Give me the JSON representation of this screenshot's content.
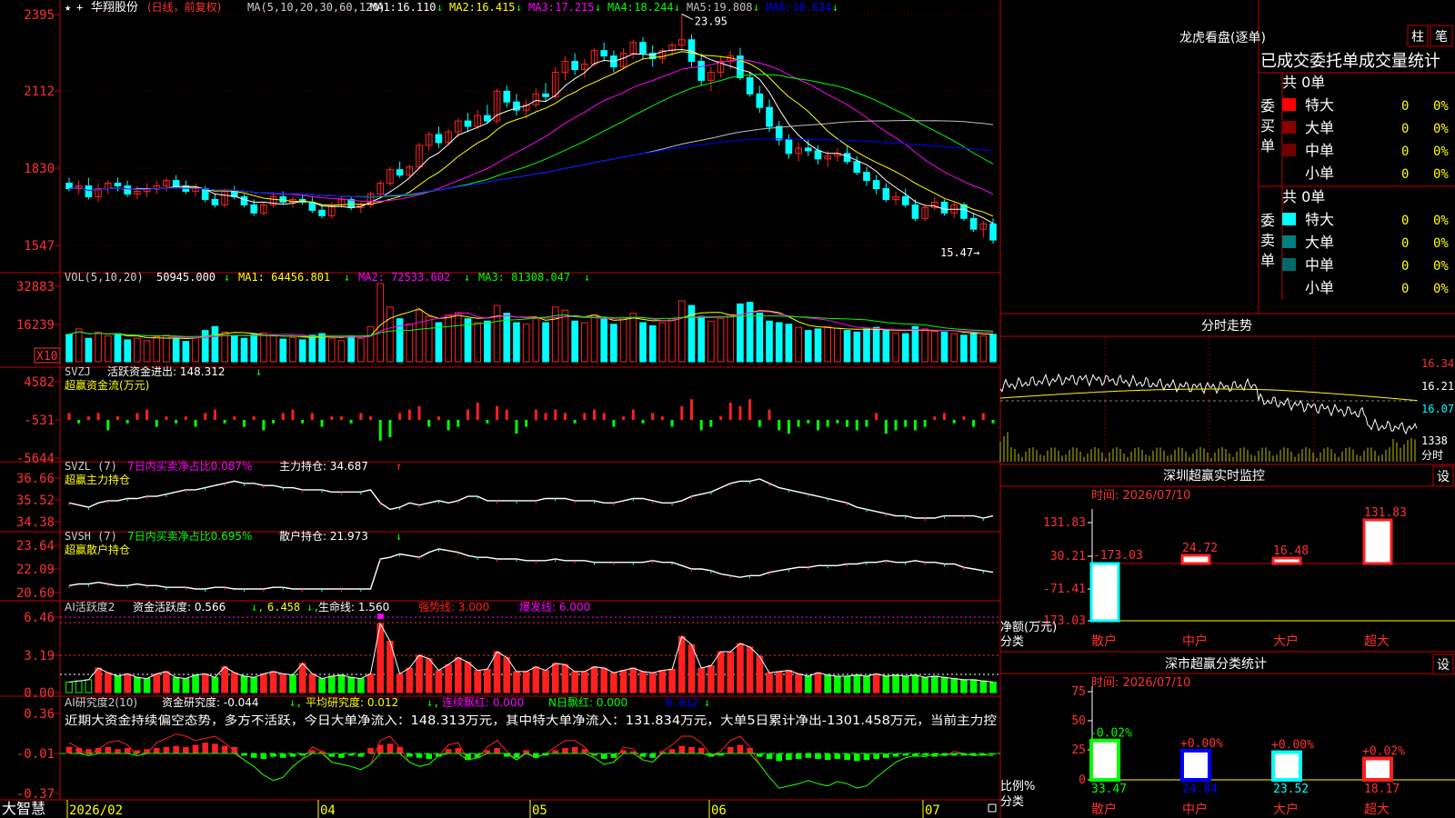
{
  "colors": {
    "up": "#ff2020",
    "down": "#00ffff",
    "grid": "#c00000",
    "bg": "#000000",
    "ma1": "#ffffff",
    "ma2": "#ffff00",
    "ma3": "#ff00ff",
    "ma4": "#00ff00",
    "ma5": "#c0c0c0",
    "ma6": "#0000ff"
  },
  "price_panel": {
    "stock": "华翔股份",
    "mode": "(日线，前复权)",
    "ma_params": "MA(5,10,20,30,60,120)",
    "ma_values": [
      {
        "label": "MA1:",
        "value": "16.110",
        "arrow": "↓"
      },
      {
        "label": "MA2:",
        "value": "16.415",
        "arrow": "↓"
      },
      {
        "label": "MA3:",
        "value": "17.215",
        "arrow": "↓"
      },
      {
        "label": "MA4:",
        "value": "18.244",
        "arrow": "↓"
      },
      {
        "label": "MA5:",
        "value": "19.808",
        "arrow": "↓"
      },
      {
        "label": "MA6:",
        "value": "18.624",
        "arrow": "↓"
      }
    ],
    "y_ticks": [
      "2395",
      "2112",
      "1830",
      "1547"
    ],
    "high_marker": "23.95",
    "low_marker": "15.47→"
  },
  "vol_panel": {
    "header": "VOL(5,10,20)",
    "value": "50945.000",
    "arrow": "↓",
    "ma1": "MA1: 64456.801",
    "ma2": "MA2: 72533.602",
    "ma3": "MA3: 81308.047",
    "y_ticks": [
      "32883",
      "16239"
    ],
    "unit": "X10"
  },
  "svzj_panel": {
    "header": "SVZJ",
    "label": "活跃资金进出: 148.312",
    "arrow": "↓",
    "subtitle": "超赢资金流(万元)",
    "y_ticks": [
      "4582",
      "-531",
      "-5644"
    ]
  },
  "svzl_panel": {
    "header": "SVZL (7)",
    "ratio": "7日内买卖净占比0.087%",
    "hold": "主力持仓: 34.687",
    "arrow": "↑",
    "subtitle": "超赢主力持仓",
    "y_ticks": [
      "36.66",
      "35.52",
      "34.38"
    ]
  },
  "svsh_panel": {
    "header": "SVSH (7)",
    "ratio": "7日内买卖净占比0.695%",
    "hold": "散户持仓: 21.973",
    "arrow": "↓",
    "subtitle": "超赢散户持仓",
    "y_ticks": [
      "23.64",
      "22.09",
      "20.60"
    ]
  },
  "ai_active_panel": {
    "header": "AI活跃度2",
    "line1": "资金活跃度: 0.566",
    "v2": "6.458",
    "line3": "生命线: 1.560",
    "line4": "强势线: 3.000",
    "line5": "爆发线: 6.000",
    "y_ticks": [
      "6.46",
      "3.19",
      "0.00"
    ]
  },
  "ai_research_panel": {
    "header": "AI研究度2(10)",
    "r1": "资金研究度: -0.044",
    "r2": "平均研究度: 0.012",
    "r3": "连续飘红: 0.000",
    "r4": "N日飘红: 0.000",
    "r5": "0.012",
    "commentary": "近期大资金持续偏空态势，多方不活跃，今日大单净流入：148.313万元，其中特大单净流入：131.834万元，大单5日累计净出-1301.458万元，当前主力控",
    "y_ticks": [
      "0.36",
      "-0.01",
      "-0.37"
    ]
  },
  "date_axis": {
    "brand": "大智慧",
    "labels": [
      "2026/02",
      "04",
      "05",
      "06",
      "07"
    ]
  },
  "order_book": {
    "title": "龙虎看盘(逐单)",
    "btn_bar": "柱",
    "btn_line": "笔",
    "section_title": "已成交委托单成交量统计",
    "buy": {
      "side": "委买单",
      "total": "共 0单",
      "rows": [
        {
          "name": "特大",
          "qty": "0",
          "pct": "0%"
        },
        {
          "name": "大单",
          "qty": "0",
          "pct": "0%"
        },
        {
          "name": "中单",
          "qty": "0",
          "pct": "0%"
        },
        {
          "name": "小单",
          "qty": "0",
          "pct": "0%"
        }
      ]
    },
    "sell": {
      "side": "委卖单",
      "total": "共 0单",
      "rows": [
        {
          "name": "特大",
          "qty": "0",
          "pct": "0%"
        },
        {
          "name": "大单",
          "qty": "0",
          "pct": "0%"
        },
        {
          "name": "中单",
          "qty": "0",
          "pct": "0%"
        },
        {
          "name": "小单",
          "qty": "0",
          "pct": "0%"
        }
      ]
    }
  },
  "intraday": {
    "title": "分时走势",
    "price_ticks": [
      "16.34",
      "16.21",
      "16.07"
    ],
    "vol_tick": "1338",
    "unit": "分时"
  },
  "monitor": {
    "title": "深圳超赢实时监控",
    "set": "设",
    "time": "时间: 2026/07/10",
    "y_ticks": [
      "131.83",
      "30.21",
      "-71.41",
      "-173.03"
    ],
    "label_net": "净额(万元)",
    "label_class": "分类",
    "cats": [
      "散户",
      "中户",
      "大户",
      "超大"
    ],
    "vals": [
      "-173.03",
      "24.72",
      "16.48",
      "131.83"
    ]
  },
  "classify": {
    "title": "深市超赢分类统计",
    "set": "设",
    "time": "时间: 2026/07/10",
    "y_ticks": [
      "75",
      "50",
      "25",
      "0"
    ],
    "label_ratio": "比例%",
    "label_class": "分类",
    "cats": [
      "散户",
      "中户",
      "大户",
      "超大"
    ],
    "changes": [
      "-0.02%",
      "+0.00%",
      "+0.00%",
      "+0.02%"
    ],
    "vals": [
      "33.47",
      "24.84",
      "23.52",
      "18.17"
    ]
  },
  "chart_data": {
    "type": "candlestick",
    "title": "华翔股份(日线，前复权)",
    "y_range": [
      15.47,
      23.95
    ],
    "x_labels": [
      "2026/02",
      "04",
      "05",
      "06",
      "07"
    ],
    "ohlc": [
      [
        17.7,
        17.9,
        17.4,
        17.5
      ],
      [
        17.5,
        17.8,
        17.3,
        17.6
      ],
      [
        17.6,
        17.9,
        17.1,
        17.2
      ],
      [
        17.2,
        17.7,
        17.0,
        17.5
      ],
      [
        17.5,
        17.8,
        17.3,
        17.7
      ],
      [
        17.7,
        17.9,
        17.4,
        17.6
      ],
      [
        17.6,
        17.8,
        17.2,
        17.3
      ],
      [
        17.3,
        17.6,
        17.1,
        17.4
      ],
      [
        17.4,
        17.7,
        17.2,
        17.5
      ],
      [
        17.5,
        17.8,
        17.3,
        17.6
      ],
      [
        17.6,
        17.9,
        17.4,
        17.8
      ],
      [
        17.8,
        18.0,
        17.5,
        17.6
      ],
      [
        17.6,
        17.8,
        17.3,
        17.4
      ],
      [
        17.4,
        17.7,
        17.2,
        17.5
      ],
      [
        17.5,
        17.6,
        17.0,
        17.1
      ],
      [
        17.1,
        17.3,
        16.8,
        16.9
      ],
      [
        16.9,
        17.5,
        16.8,
        17.4
      ],
      [
        17.4,
        17.6,
        17.1,
        17.2
      ],
      [
        17.2,
        17.3,
        16.8,
        16.9
      ],
      [
        16.9,
        17.1,
        16.5,
        16.6
      ],
      [
        16.6,
        17.0,
        16.5,
        16.9
      ],
      [
        16.9,
        17.3,
        16.8,
        17.2
      ],
      [
        17.2,
        17.4,
        16.9,
        17.0
      ],
      [
        17.0,
        17.2,
        16.8,
        17.1
      ],
      [
        17.1,
        17.3,
        16.9,
        17.0
      ],
      [
        17.0,
        17.2,
        16.6,
        16.7
      ],
      [
        16.7,
        16.9,
        16.4,
        16.5
      ],
      [
        16.5,
        17.0,
        16.4,
        16.9
      ],
      [
        16.9,
        17.2,
        16.8,
        17.1
      ],
      [
        17.1,
        17.2,
        16.7,
        16.8
      ],
      [
        16.8,
        17.0,
        16.6,
        16.9
      ],
      [
        16.9,
        17.4,
        16.8,
        17.3
      ],
      [
        17.3,
        17.8,
        17.2,
        17.7
      ],
      [
        17.7,
        18.3,
        17.6,
        18.2
      ],
      [
        18.2,
        18.5,
        17.9,
        18.0
      ],
      [
        18.0,
        18.4,
        17.9,
        18.3
      ],
      [
        18.3,
        19.2,
        18.2,
        19.1
      ],
      [
        19.1,
        19.6,
        18.9,
        19.5
      ],
      [
        19.5,
        19.8,
        19.0,
        19.2
      ],
      [
        19.2,
        19.7,
        19.1,
        19.6
      ],
      [
        19.6,
        20.1,
        19.4,
        20.0
      ],
      [
        20.0,
        20.3,
        19.6,
        19.8
      ],
      [
        19.8,
        20.4,
        19.7,
        20.2
      ],
      [
        20.2,
        20.6,
        19.9,
        20.0
      ],
      [
        20.0,
        21.2,
        19.9,
        21.1
      ],
      [
        21.1,
        21.3,
        20.5,
        20.7
      ],
      [
        20.7,
        21.0,
        20.2,
        20.4
      ],
      [
        20.4,
        20.8,
        20.1,
        20.6
      ],
      [
        20.6,
        21.2,
        20.5,
        21.0
      ],
      [
        21.0,
        21.4,
        20.7,
        20.9
      ],
      [
        20.9,
        22.0,
        20.8,
        21.8
      ],
      [
        21.8,
        22.4,
        21.5,
        22.2
      ],
      [
        22.2,
        22.5,
        21.7,
        21.9
      ],
      [
        21.9,
        22.3,
        21.6,
        22.1
      ],
      [
        22.1,
        22.7,
        22.0,
        22.6
      ],
      [
        22.6,
        22.9,
        22.2,
        22.4
      ],
      [
        22.4,
        22.6,
        21.8,
        22.0
      ],
      [
        22.0,
        22.7,
        21.9,
        22.5
      ],
      [
        22.5,
        23.0,
        22.3,
        22.9
      ],
      [
        22.9,
        23.1,
        22.3,
        22.5
      ],
      [
        22.5,
        22.8,
        22.0,
        22.3
      ],
      [
        22.3,
        22.7,
        22.1,
        22.6
      ],
      [
        22.6,
        22.9,
        22.4,
        22.8
      ],
      [
        22.8,
        23.95,
        22.6,
        23.0
      ],
      [
        23.0,
        23.2,
        22.0,
        22.2
      ],
      [
        22.2,
        22.5,
        21.3,
        21.5
      ],
      [
        21.5,
        22.0,
        21.1,
        21.8
      ],
      [
        21.8,
        22.4,
        21.6,
        22.2
      ],
      [
        22.2,
        22.6,
        21.9,
        22.4
      ],
      [
        22.4,
        22.7,
        21.5,
        21.6
      ],
      [
        21.6,
        21.8,
        20.9,
        21.0
      ],
      [
        21.0,
        21.3,
        20.3,
        20.5
      ],
      [
        20.5,
        20.8,
        19.6,
        19.8
      ],
      [
        19.8,
        20.0,
        19.1,
        19.3
      ],
      [
        19.3,
        19.5,
        18.6,
        18.8
      ],
      [
        18.8,
        19.2,
        18.5,
        19.0
      ],
      [
        19.0,
        19.3,
        18.7,
        18.9
      ],
      [
        18.9,
        19.1,
        18.4,
        18.6
      ],
      [
        18.6,
        18.9,
        18.3,
        18.7
      ],
      [
        18.7,
        19.0,
        18.5,
        18.8
      ],
      [
        18.8,
        19.1,
        18.4,
        18.5
      ],
      [
        18.5,
        18.7,
        18.0,
        18.1
      ],
      [
        18.1,
        18.3,
        17.6,
        17.8
      ],
      [
        17.8,
        18.0,
        17.3,
        17.5
      ],
      [
        17.5,
        17.7,
        17.0,
        17.1
      ],
      [
        17.1,
        17.4,
        16.9,
        17.2
      ],
      [
        17.2,
        17.5,
        16.8,
        16.9
      ],
      [
        16.9,
        17.1,
        16.3,
        16.4
      ],
      [
        16.4,
        16.9,
        16.3,
        16.8
      ],
      [
        16.8,
        17.2,
        16.7,
        17.0
      ],
      [
        17.0,
        17.1,
        16.5,
        16.6
      ],
      [
        16.6,
        17.0,
        16.4,
        16.9
      ],
      [
        16.9,
        17.0,
        16.3,
        16.4
      ],
      [
        16.4,
        16.6,
        15.9,
        16.0
      ],
      [
        16.0,
        16.3,
        15.7,
        16.2
      ],
      [
        16.2,
        16.4,
        15.47,
        15.6
      ]
    ],
    "ma": {
      "MA1": 16.11,
      "MA2": 16.415,
      "MA3": 17.215,
      "MA4": 18.244,
      "MA5": 19.808,
      "MA6": 18.624
    },
    "volume": {
      "last": 50945.0,
      "ma1": 64456.801,
      "ma2": 72533.602,
      "ma3": 81308.047
    },
    "monitor_net": {
      "散户": -173.03,
      "中户": 24.72,
      "大户": 16.48,
      "超大": 131.83
    },
    "classify_ratio": {
      "散户": 33.47,
      "中户": 24.84,
      "大户": 23.52,
      "超大": 18.17
    }
  }
}
